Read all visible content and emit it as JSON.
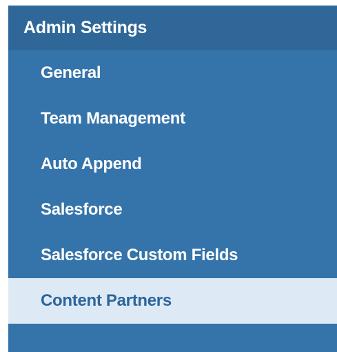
{
  "sidebar": {
    "title": "Admin Settings",
    "items": [
      {
        "label": "General",
        "active": false
      },
      {
        "label": "Team Management",
        "active": false
      },
      {
        "label": "Auto Append",
        "active": false
      },
      {
        "label": "Salesforce",
        "active": false
      },
      {
        "label": "Salesforce Custom Fields",
        "active": false
      },
      {
        "label": "Content Partners",
        "active": true
      }
    ]
  },
  "colors": {
    "panel_bg": "#3574aa",
    "header_bg": "#2f6898",
    "active_bg": "#ddeaf6",
    "active_text": "#2d659a",
    "text": "#ffffff"
  }
}
